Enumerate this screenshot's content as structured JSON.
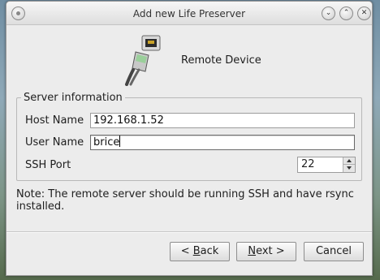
{
  "window": {
    "title": "Add new Life Preserver"
  },
  "header": {
    "title": "Remote Device",
    "icon": "network-cable-icon"
  },
  "server_info": {
    "group_title": "Server information",
    "host_label": "Host Name",
    "host_value": "192.168.1.52",
    "user_label": "User Name",
    "user_value": "brice",
    "port_label": "SSH Port",
    "port_value": "22"
  },
  "note": {
    "line1": "Note: The remote server should be running SSH and have rsync",
    "line2": "installed."
  },
  "buttons": {
    "back_prefix": "< ",
    "back_mnemonic": "B",
    "back_rest": "ack",
    "next_mnemonic": "N",
    "next_rest": "ext >",
    "cancel": "Cancel"
  }
}
